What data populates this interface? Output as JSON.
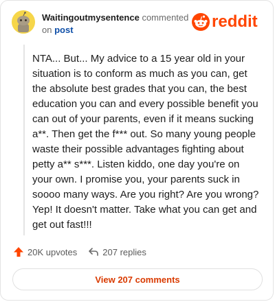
{
  "comment": {
    "username": "Waitingoutmysentence",
    "action_text": "commented",
    "on_text": "on",
    "post_link": "post",
    "body": "NTA... But... My advice to a 15 year old in your situation is to conform as much as you can, get the absolute best grades that you can, the best education you can and every possible benefit you can out of your parents, even if it means sucking a**. Then get the f*** out. So many young people waste their possible advantages fighting about petty a** s***. Listen kiddo, one day you're on your own. I promise you, your parents suck in soooo many ways. Are you right? Are you wrong? Yep! It doesn't matter. Take what you can get and get out fast!!!"
  },
  "brand": {
    "wordmark": "reddit",
    "icon": "reddit-snoo-icon",
    "color": "#ff4500"
  },
  "actions": {
    "upvotes": "20K upvotes",
    "upvote_icon": "upvote-arrow-icon",
    "upvote_color": "#ff4500",
    "replies": "207 replies",
    "reply_icon": "reply-arrow-icon"
  },
  "footer": {
    "view_comments": "View 207 comments"
  }
}
